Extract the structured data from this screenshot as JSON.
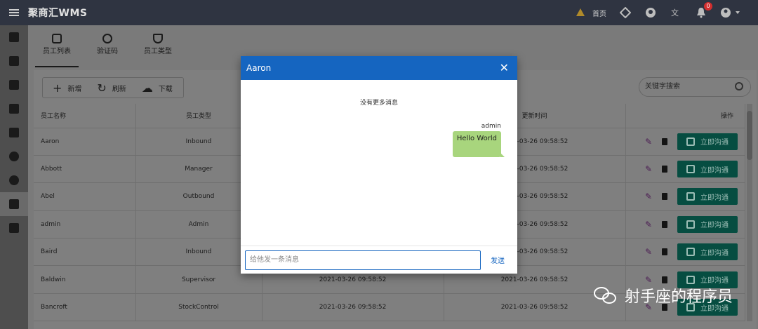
{
  "app": {
    "title": "聚商汇WMS"
  },
  "topbar": {
    "home_label": "首页",
    "notification_count": "0"
  },
  "tabs": [
    {
      "label": "员工列表",
      "icon": "badge-icon"
    },
    {
      "label": "验证码",
      "icon": "verified-icon"
    },
    {
      "label": "员工类型",
      "icon": "shield-icon"
    }
  ],
  "toolbar": {
    "add_label": "新增",
    "refresh_label": "刷新",
    "download_label": "下载"
  },
  "search": {
    "placeholder": "关键字搜索"
  },
  "table": {
    "headers": [
      "员工名称",
      "员工类型",
      "",
      "更新时间",
      "操作"
    ],
    "rows": [
      {
        "name": "Aaron",
        "type": "Inbound",
        "created": "",
        "updated": "2021-03-26 09:58:52"
      },
      {
        "name": "Abbott",
        "type": "Manager",
        "created": "",
        "updated": "2021-03-26 09:58:52"
      },
      {
        "name": "Abel",
        "type": "Outbound",
        "created": "",
        "updated": "2021-03-26 09:58:52"
      },
      {
        "name": "admin",
        "type": "Admin",
        "created": "",
        "updated": "2021-03-26 09:58:52"
      },
      {
        "name": "Baird",
        "type": "Inbound",
        "created": "",
        "updated": "2021-03-26 09:58:52"
      },
      {
        "name": "Baldwin",
        "type": "Supervisor",
        "created": "2021-03-26 09:58:52",
        "updated": "2021-03-26 09:58:52"
      },
      {
        "name": "Bancroft",
        "type": "StockControl",
        "created": "2021-03-26 09:58:52",
        "updated": "2021-03-26 09:58:52"
      }
    ],
    "chat_label": "立即沟通"
  },
  "dialog": {
    "title": "Aaron",
    "no_more": "没有更多消息",
    "sender": "admin",
    "message": "Hello World",
    "input_placeholder": "给他发一条消息",
    "send_label": "发送"
  },
  "watermark": {
    "text": "射手座的程序员"
  },
  "colors": {
    "dialog_header": "#1565c0",
    "bubble": "#a8d57d",
    "chat_button": "#064d41",
    "topbar": "#2f3441"
  }
}
